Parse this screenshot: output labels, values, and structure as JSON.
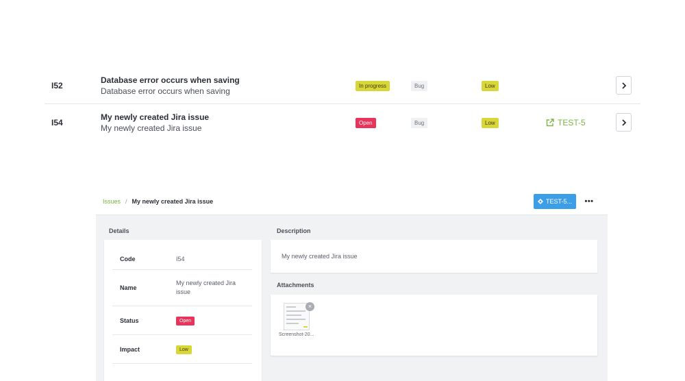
{
  "issues": [
    {
      "code": "I52",
      "title": "Database error occurs when saving",
      "subtitle": "Database error occurs when saving",
      "status": "In progress",
      "type": "Bug",
      "impact": "Low",
      "jira": ""
    },
    {
      "code": "I54",
      "title": "My newly created Jira issue",
      "subtitle": "My newly created Jira issue",
      "status": "Open",
      "type": "Bug",
      "impact": "Low",
      "jira": "TEST-5"
    }
  ],
  "detail": {
    "breadcrumb": {
      "parent": "Issues",
      "separator": "/",
      "current": "My newly created Jira issue"
    },
    "jira_button": "TEST-5...",
    "more_label": "•••",
    "details_label": "Details",
    "fields": {
      "code": {
        "key": "Code",
        "value": "I54"
      },
      "name": {
        "key": "Name",
        "value": "My newly created Jira issue"
      },
      "status": {
        "key": "Status",
        "value": "Open"
      },
      "impact": {
        "key": "Impact",
        "value": "Low"
      }
    },
    "description_label": "Description",
    "description": "My newly created Jira issue",
    "attachments_label": "Attachments",
    "attachment": {
      "name": "Screenshot-20...",
      "remove": "×"
    }
  },
  "colors": {
    "accent_green": "#7ab541",
    "jira_blue": "#3d9ee8",
    "status_open": "#e8335a",
    "status_in_progress": "#d9d63a",
    "impact_low": "#d9d63a"
  },
  "icons": {
    "external_link": "external-link-icon",
    "chevron": "chevron-right-icon",
    "jira": "jira-diamond-icon",
    "more": "more-dots-icon",
    "remove": "close-icon"
  }
}
